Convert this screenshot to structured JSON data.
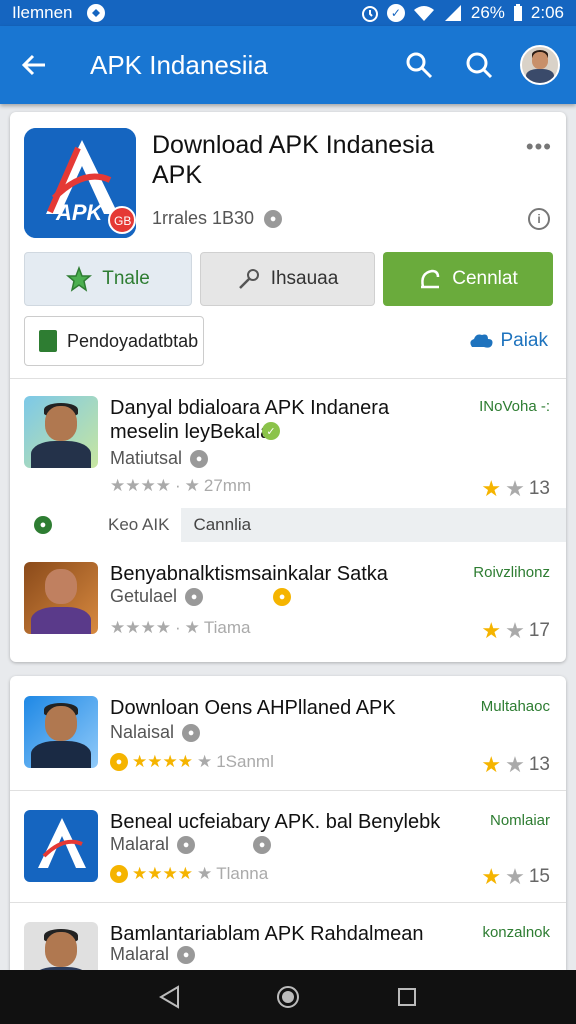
{
  "status_bar": {
    "carrier": "Ilemnen",
    "battery_pct": "26%",
    "time": "2:06"
  },
  "app_bar": {
    "title": "APK Indanesiia"
  },
  "app_header": {
    "title": "Download APK Indanesia APK",
    "meta": "1rrales 1B30",
    "icon_text": "APK",
    "icon_badge": "GB"
  },
  "actions": {
    "btn1": "Tnale",
    "btn2": "Ihsauaa",
    "btn3": "Cennlat",
    "chip": "Pendoyadatbtab",
    "link": "Paiak"
  },
  "filter": {
    "label": "Keo AIK",
    "value": "Cannlia"
  },
  "list": [
    {
      "title": "Danyal bdialoara APK Indanera meselin leyBekala",
      "subtitle": "Matiutsal",
      "stars_text": "27mm",
      "tag": "INoVoha -:",
      "rating": "13"
    },
    {
      "title": "Benyabnalktismsainkalar Satka",
      "subtitle": "Getulael",
      "stars_text": "Tiama",
      "tag": "Roivzlihonz",
      "rating": "17"
    },
    {
      "title": "Downloan Oens AHPllaned APK",
      "subtitle": "Nalaisal",
      "stars_text": "1Sanml",
      "tag": "Multahaoc",
      "rating": "13"
    },
    {
      "title": "Beneal ucfeiabary APK. bal Benylebk",
      "subtitle": "Malaral",
      "stars_text": "Tlanna",
      "tag": "Nomlaiar",
      "rating": "15"
    },
    {
      "title": "Bamlantariablam APK Rahdalmean",
      "subtitle": "Malaral",
      "stars_text": "",
      "tag": "konzalnok",
      "rating": ""
    }
  ],
  "colors": {
    "app_bar": "#1976d2",
    "status_bar": "#1565c0",
    "accent_green": "#6aab3c",
    "star_gold": "#f5b400"
  }
}
